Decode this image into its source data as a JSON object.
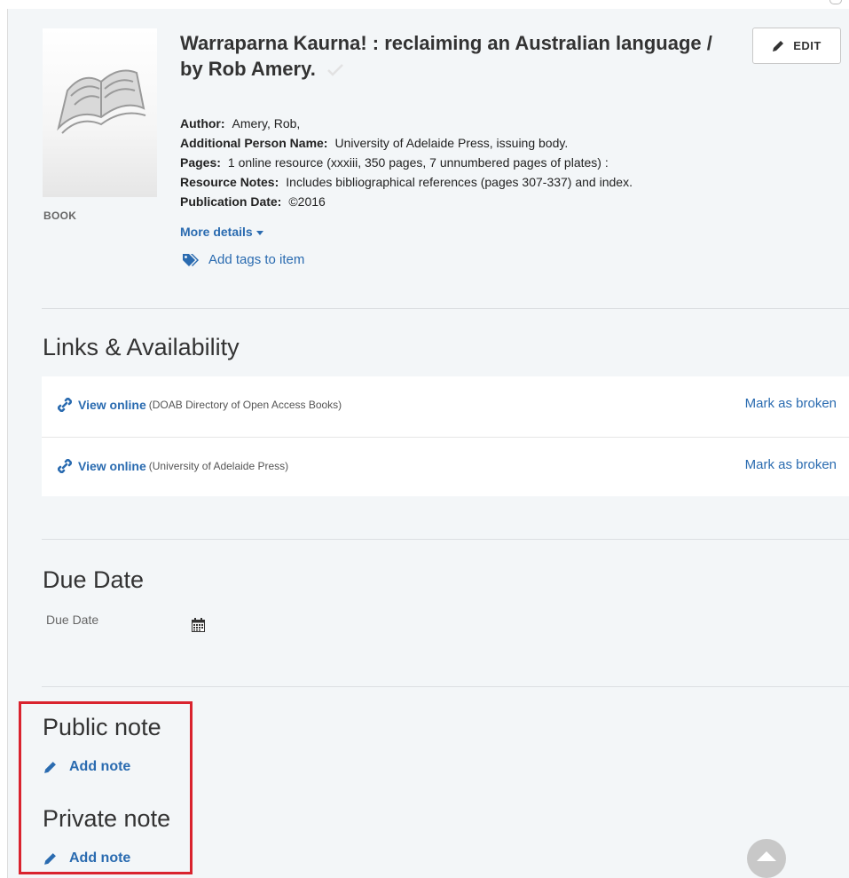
{
  "record": {
    "type_label": "BOOK",
    "title": "Warraparna Kaurna! : reclaiming an Australian language / by Rob Amery.",
    "edit_label": "EDIT",
    "fields": [
      {
        "label": "Author:",
        "value": "Amery, Rob,",
        "value_is_link": false
      },
      {
        "label": "Additional Person Name:",
        "value": "University of Adelaide Press, issuing body.",
        "value_is_link": false
      },
      {
        "label": "Pages:",
        "value": "1 online resource (xxxiii, 350 pages, 7 unnumbered pages of plates) :",
        "value_is_link": false
      },
      {
        "label": "Resource Notes:",
        "value": "Includes bibliographical references (pages 307-337) and index.",
        "value_is_link": false
      },
      {
        "label": "Publication Date:",
        "value": "©2016",
        "value_is_link": false
      }
    ],
    "more_details": "More details",
    "add_tags": "Add tags to item"
  },
  "links_availability": {
    "heading": "Links & Availability",
    "rows": [
      {
        "view_label": "View online",
        "source": "(DOAB Directory of Open Access Books)",
        "broken_label": "Mark as broken"
      },
      {
        "view_label": "View online",
        "source": "(University of Adelaide Press)",
        "broken_label": "Mark as broken"
      }
    ]
  },
  "due_date": {
    "heading": "Due Date",
    "field_label": "Due Date"
  },
  "public_note": {
    "heading": "Public note",
    "add_label": "Add note"
  },
  "private_note": {
    "heading": "Private note",
    "add_label": "Add note"
  },
  "icons": {
    "edit": "pencil-icon",
    "tags": "tags-icon",
    "link": "link-icon",
    "calendar": "calendar-icon",
    "note": "pencil-icon",
    "check": "check-icon",
    "scroll_top": "chevron-up-icon"
  },
  "colors": {
    "link": "#2a6bb0",
    "background": "#f3f6f8",
    "highlight": "#d9232e"
  }
}
